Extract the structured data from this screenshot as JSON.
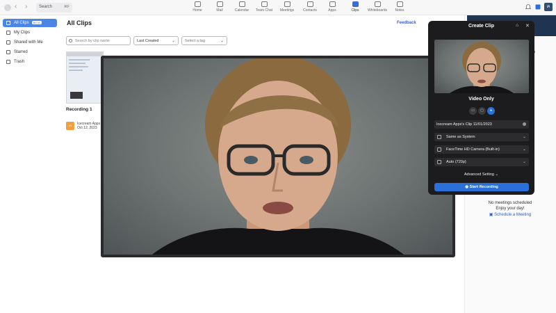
{
  "topbar": {
    "search_placeholder": "Search",
    "search_shortcut": "⌘F",
    "nav": [
      {
        "label": "Home",
        "icon": "home-icon"
      },
      {
        "label": "Mail",
        "icon": "mail-icon"
      },
      {
        "label": "Calendar",
        "icon": "calendar-icon"
      },
      {
        "label": "Team Chat",
        "icon": "chat-icon"
      },
      {
        "label": "Meetings",
        "icon": "video-icon"
      },
      {
        "label": "Contacts",
        "icon": "contacts-icon"
      },
      {
        "label": "Apps",
        "icon": "apps-icon"
      },
      {
        "label": "Clips",
        "icon": "clips-icon",
        "active": true
      },
      {
        "label": "Whiteboards",
        "icon": "whiteboard-icon"
      },
      {
        "label": "Notes",
        "icon": "notes-icon"
      }
    ],
    "avatar_initials": "IA"
  },
  "sidebar": {
    "items": [
      {
        "label": "All Clips",
        "badge": "BETA",
        "active": true
      },
      {
        "label": "My Clips"
      },
      {
        "label": "Shared with Me"
      },
      {
        "label": "Starred"
      },
      {
        "label": "Trash"
      }
    ]
  },
  "main": {
    "title": "All Clips",
    "feedback_label": "Feedback",
    "search_placeholder": "Search by clip name",
    "sort_value": "Last Created",
    "tag_placeholder": "Select a tag",
    "clip": {
      "title": "Recording 1",
      "owner_initials": "IA",
      "owner_name": "Icecream Apps",
      "date": "Oct 12, 2023"
    }
  },
  "calendar": {
    "no_meetings": "No meetings scheduled",
    "enjoy": "Enjoy your day!",
    "schedule_label": "Schedule a Meeting"
  },
  "create_clip": {
    "title": "Create Clip",
    "mode_label": "Video Only",
    "clip_name": "Icecream Apps's Clip 11/01/2023",
    "audio_value": "Same as System",
    "camera_value": "FaceTime HD Camera (Built-in)",
    "quality_value": "Auto (720p)",
    "advanced_label": "Advanced Setting",
    "start_label": "Start Recording"
  },
  "colors": {
    "accent": "#2b6fd9",
    "sidebar_active": "#4a86e8",
    "panel_bg": "#1c1c1e"
  }
}
